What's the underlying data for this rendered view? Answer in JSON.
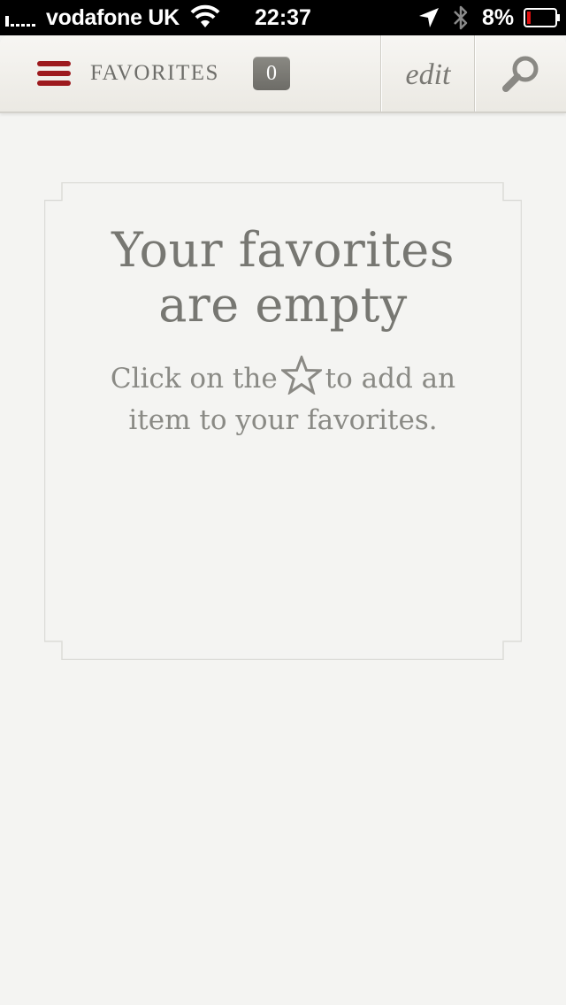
{
  "status_bar": {
    "carrier": "vodafone UK",
    "time": "22:37",
    "battery_percent": "8%",
    "icons": [
      "signal-icon",
      "wifi-icon",
      "location-arrow-icon",
      "bluetooth-icon",
      "battery-icon"
    ]
  },
  "nav": {
    "title": "FAVORITES",
    "count": "0",
    "edit_label": "edit",
    "accent_color": "#9d1a1e",
    "icons": [
      "menu-icon",
      "search-icon"
    ]
  },
  "empty_state": {
    "title_line1": "Your favorites",
    "title_line2": "are empty",
    "message_before": "Click on the",
    "message_after": "to add an",
    "message_line2": "item to your favorites.",
    "icon": "star-outline-icon"
  }
}
